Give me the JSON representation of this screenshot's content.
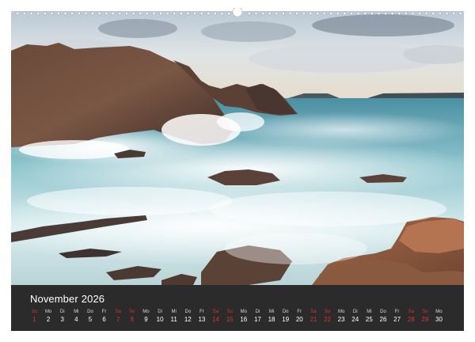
{
  "calendar": {
    "month": "November",
    "year": "2026",
    "days": [
      {
        "wd": "So",
        "dn": "1",
        "weekend": true
      },
      {
        "wd": "Mo",
        "dn": "2",
        "weekend": false
      },
      {
        "wd": "Di",
        "dn": "3",
        "weekend": false
      },
      {
        "wd": "Mi",
        "dn": "4",
        "weekend": false
      },
      {
        "wd": "Do",
        "dn": "5",
        "weekend": false
      },
      {
        "wd": "Fr",
        "dn": "6",
        "weekend": false
      },
      {
        "wd": "Sa",
        "dn": "7",
        "weekend": true
      },
      {
        "wd": "So",
        "dn": "8",
        "weekend": true
      },
      {
        "wd": "Mo",
        "dn": "9",
        "weekend": false
      },
      {
        "wd": "Di",
        "dn": "10",
        "weekend": false
      },
      {
        "wd": "Mi",
        "dn": "11",
        "weekend": false
      },
      {
        "wd": "Do",
        "dn": "12",
        "weekend": false
      },
      {
        "wd": "Fr",
        "dn": "13",
        "weekend": false
      },
      {
        "wd": "Sa",
        "dn": "14",
        "weekend": true
      },
      {
        "wd": "So",
        "dn": "15",
        "weekend": true
      },
      {
        "wd": "Mo",
        "dn": "16",
        "weekend": false
      },
      {
        "wd": "Di",
        "dn": "17",
        "weekend": false
      },
      {
        "wd": "Mi",
        "dn": "18",
        "weekend": false
      },
      {
        "wd": "Do",
        "dn": "19",
        "weekend": false
      },
      {
        "wd": "Fr",
        "dn": "20",
        "weekend": false
      },
      {
        "wd": "Sa",
        "dn": "21",
        "weekend": true
      },
      {
        "wd": "So",
        "dn": "22",
        "weekend": true
      },
      {
        "wd": "Mo",
        "dn": "23",
        "weekend": false
      },
      {
        "wd": "Di",
        "dn": "24",
        "weekend": false
      },
      {
        "wd": "Mi",
        "dn": "25",
        "weekend": false
      },
      {
        "wd": "Do",
        "dn": "26",
        "weekend": false
      },
      {
        "wd": "Fr",
        "dn": "27",
        "weekend": false
      },
      {
        "wd": "Sa",
        "dn": "28",
        "weekend": true
      },
      {
        "wd": "So",
        "dn": "29",
        "weekend": true
      },
      {
        "wd": "Mo",
        "dn": "30",
        "weekend": false
      }
    ]
  },
  "colors": {
    "strip": "#2b2b2b",
    "weekend": "#d9342b",
    "text": "#ffffff"
  },
  "photo": {
    "subject": "rocky-coast-surf"
  }
}
